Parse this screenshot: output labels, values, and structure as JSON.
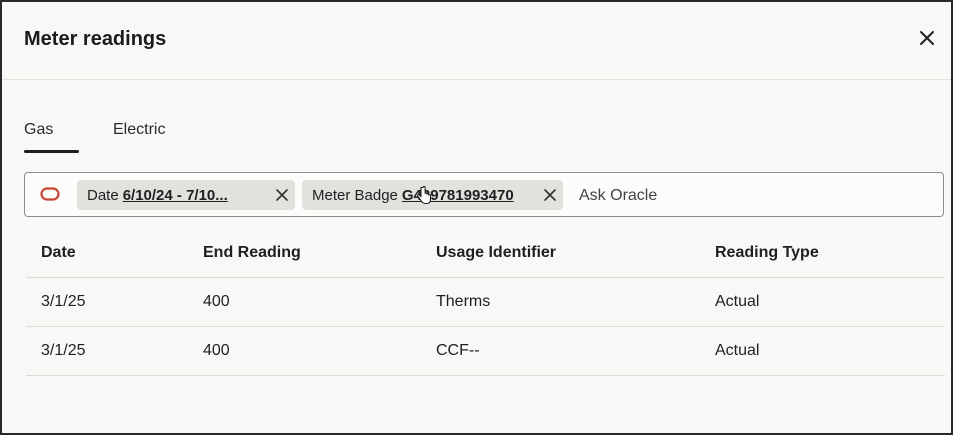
{
  "dialog": {
    "title": "Meter readings",
    "close_icon": "close-icon"
  },
  "tabs": [
    {
      "label": "Gas",
      "selected": true
    },
    {
      "label": "Electric",
      "selected": false
    }
  ],
  "filter_bar": {
    "oracle_icon": "oracle-logo-icon",
    "chips": [
      {
        "key": "Date",
        "value": "6/10/24 - 7/10..."
      },
      {
        "key": "Meter Badge",
        "value": "G439781993470"
      }
    ],
    "placeholder": "Ask Oracle"
  },
  "table": {
    "columns": [
      "Date",
      "End Reading",
      "Usage Identifier",
      "Reading Type"
    ],
    "rows": [
      [
        "3/1/25",
        "400",
        "Therms",
        "Actual"
      ],
      [
        "3/1/25",
        "400",
        "CCF--",
        "Actual"
      ]
    ]
  }
}
